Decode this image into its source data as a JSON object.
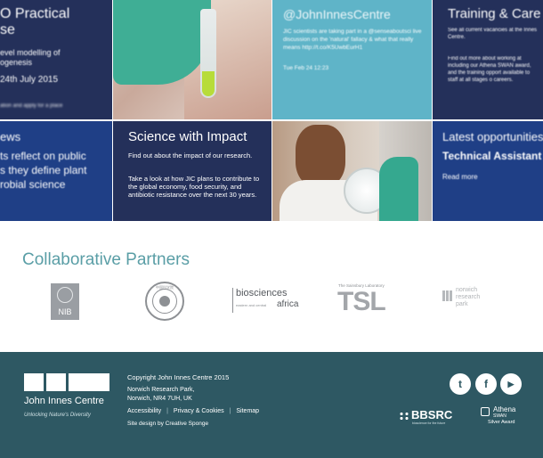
{
  "tiles": {
    "phd": {
      "title": "O Practical",
      "title2": "se",
      "body1": "evel modelling of",
      "body2": "ogenesis",
      "date": "24th July 2015",
      "apply": "ation and apply for a place"
    },
    "twitter": {
      "handle": "@JohnInnesCentre",
      "tweet": "JIC scientists are taking part in a @senseaboutsci live discussion on the 'natural' fallacy & what that really means http://t.co/K5UwbEurH1",
      "timestamp": "Tue Feb 24 12:23"
    },
    "training": {
      "title": "Training & Care",
      "body1": "See all current vacancies at the Innes Centre.",
      "body2": "Find out more about working at including our Athena SWAN award, and the training opport available to staff at all stages o careers."
    },
    "news": {
      "title": "ews",
      "line1": "ts reflect on public",
      "line2": "s they define plant",
      "line3": "robial science"
    },
    "impact": {
      "title": "Science with Impact",
      "body1": "Find out about the impact of our research.",
      "body2": "Take a look at how JIC plans to contribute to the global economy, food security, and antibiotic resistance over the next 30 years."
    },
    "opportunities": {
      "title": "Latest opportunities",
      "job": "Technical Assistant",
      "more": "Read more"
    }
  },
  "partners": {
    "title": "Collaborative Partners",
    "logos": {
      "nib": "NIB",
      "ac_top": "中国科学院",
      "biosciences_1": "biosciences",
      "biosciences_2": "eastern and central",
      "biosciences_3": "africa",
      "tsl_tag": "The Sainsbury Laboratory",
      "tsl": "TSL",
      "nrp_1": "norwich",
      "nrp_2": "research",
      "nrp_3": "park"
    }
  },
  "footer": {
    "logo_name": "John Innes Centre",
    "logo_tagline": "Unlocking Nature's Diversity",
    "copyright": "Copyright John Innes Centre 2015",
    "address1": "Norwich Research Park,",
    "address2": "Norwich, NR4 7UH, UK",
    "links": [
      "Accessibility",
      "Privacy & Cookies",
      "Sitemap"
    ],
    "credit": "Site design by Creative Sponge",
    "bbsrc": "BBSRC",
    "bbsrc_tag": "bioscience for the future",
    "athena_1": "Athena",
    "athena_2": "SWAN",
    "athena_3": "Silver Award",
    "social": [
      {
        "icon": "twitter-icon",
        "glyph": "t"
      },
      {
        "icon": "facebook-icon",
        "glyph": "f"
      },
      {
        "icon": "youtube-icon",
        "glyph": "▶"
      }
    ]
  }
}
